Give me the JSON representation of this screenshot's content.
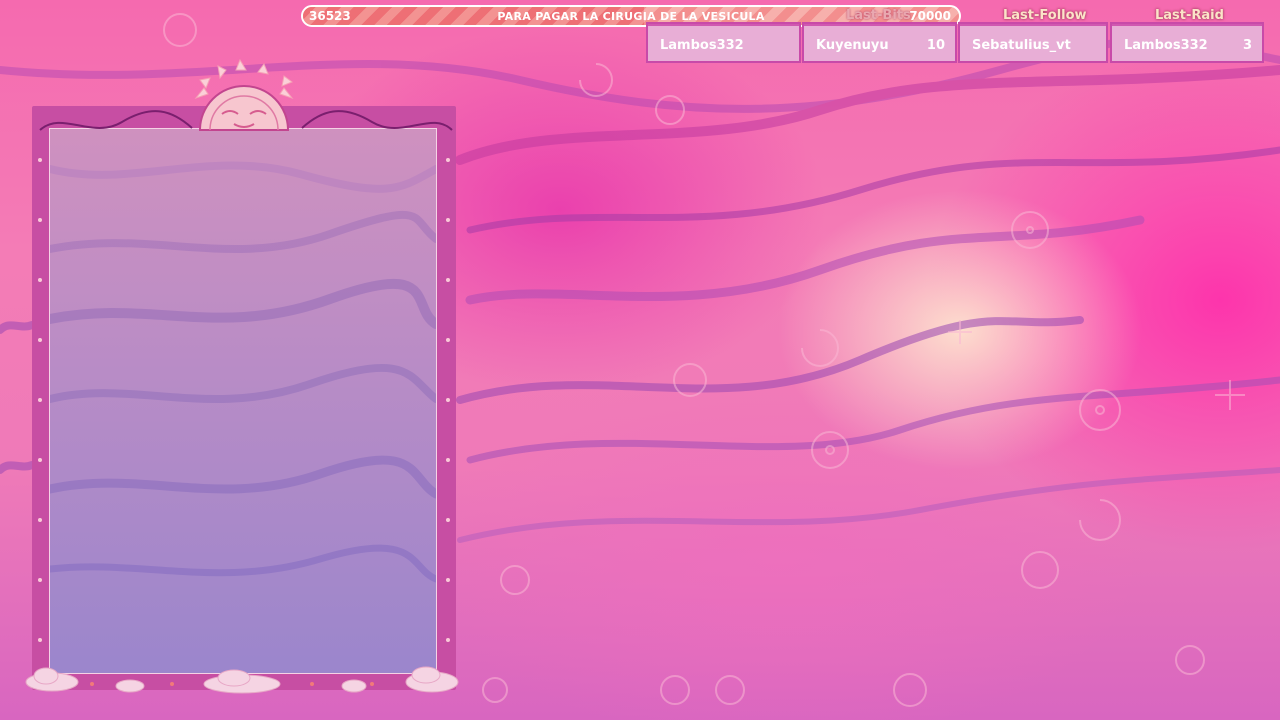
{
  "goal": {
    "current": "36523",
    "title": "PARA PAGAR LA CIRUGIA DE LA VESICULA",
    "target": "70000",
    "progress_fraction": 0.52
  },
  "last_bits": {
    "label": "Last-Bits"
  },
  "last_follow": {
    "label": "Last-Follow"
  },
  "last_raid": {
    "label": "Last-Raid"
  },
  "events": [
    {
      "name": "Lambos332",
      "count": ""
    },
    {
      "name": "Kuyenuyu",
      "count": "10"
    },
    {
      "name": "Sebatulius_vt",
      "count": ""
    },
    {
      "name": "Lambos332",
      "count": "3"
    }
  ],
  "colors": {
    "accent": "#c74ea3",
    "goal_stripe": "#f38e8e",
    "label_cream": "#fbe3c8"
  }
}
